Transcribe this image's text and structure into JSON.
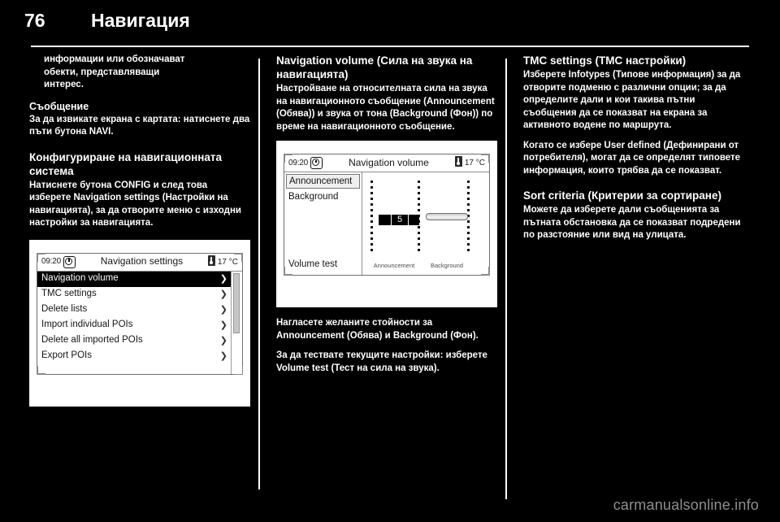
{
  "page": {
    "number": "76",
    "title": "Навигация",
    "watermark": "carmanualsonline.info"
  },
  "col1": {
    "cont_line1": "информации или обозначават",
    "cont_line2": "обекти, представляващи",
    "cont_line3": "интерес.",
    "heading_announcement": "Съобщение",
    "announcement_text": "За да извикате екрана с картата: натиснете два пъти бутона NAVI.",
    "section_heading": "Конфигуриране на навигационната система",
    "section_text": "Натиснете бутона CONFIG и след това изберете Navigation settings (Настройки на навигацията), за да отворите меню с изходни настройки за навигацията.",
    "figure": {
      "status": {
        "clock": "09:20",
        "clock_icon": "clock-icon",
        "thermo_icon": "thermometer-icon",
        "temperature": "17 °C",
        "title": "Navigation settings"
      },
      "menu_items": [
        {
          "label": "Navigation volume",
          "chevron": "❯",
          "selected": true
        },
        {
          "label": "TMC settings",
          "chevron": "❯",
          "selected": false
        },
        {
          "label": "Delete lists",
          "chevron": "❯",
          "selected": false
        },
        {
          "label": "Import individual POIs",
          "chevron": "❯",
          "selected": false
        },
        {
          "label": "Delete all imported POIs",
          "chevron": "❯",
          "selected": false
        },
        {
          "label": "Export POIs",
          "chevron": "❯",
          "selected": false
        }
      ]
    }
  },
  "col2": {
    "heading": "Navigation volume (Сила на звука на навигацията)",
    "intro_text": "Настройване на относителната сила на звука на навигационното съобщение (Announcement (Обява)) и звука от тона (Background (Фон)) по време на навигационното съобщение.",
    "figure": {
      "status": {
        "clock": "09:20",
        "clock_icon": "clock-icon",
        "thermo_icon": "thermometer-icon",
        "temperature": "17 °C",
        "title": "Navigation volume"
      },
      "left_items": [
        {
          "label": "Announcement",
          "selected": true
        },
        {
          "label": "Background",
          "selected": false
        }
      ],
      "volume_test_label": "Volume test",
      "slider_announcement_value": "5",
      "caption_announcement": "Announcement",
      "caption_background": "Background"
    },
    "after_text_1": "Нагласете желаните стойности за Announcement (Обява) и Background (Фон).",
    "after_text_2": "За да тествате текущите настройки: изберете Volume test (Тест на сила на звука)."
  },
  "col3": {
    "heading_tmc": "TMC settings (TMC настройки)",
    "tmc_text": "Изберете Infotypes (Типове информация) за да отворите подменю с различни опции; за да определите дали и кои такива пътни съобщения да се показват на екрана за активното водене по маршрута.",
    "user_defined_text": "Когато се избере User defined (Дефинирани от потребителя), могат да се определят типовете информация, които трябва да се показват.",
    "heading_sort": "Sort criteria (Критерии за сортиране)",
    "sort_text": "Можете да изберете дали съобщенията за пътната обстановка да се показват подредени по разстояние или вид на улицата."
  }
}
